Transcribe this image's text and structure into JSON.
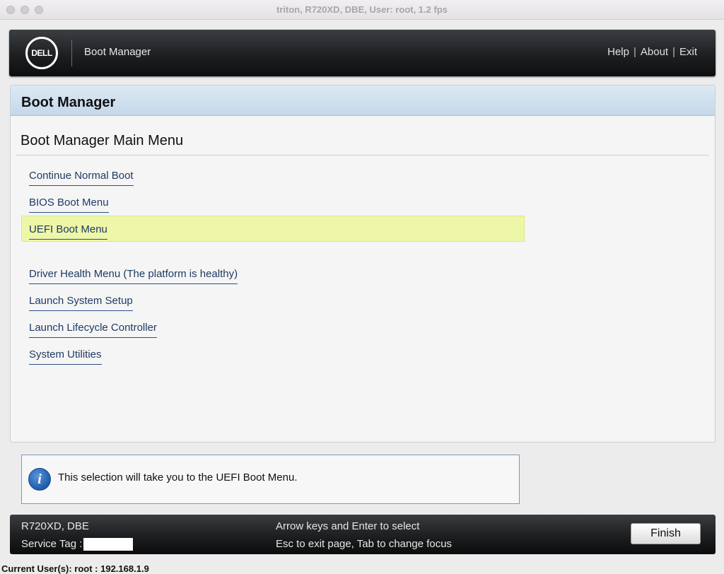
{
  "window": {
    "title": "triton, R720XD, DBE, User: root, 1.2 fps"
  },
  "header": {
    "logo_text": "DELL",
    "app_title": "Boot Manager",
    "links": {
      "help": "Help",
      "about": "About",
      "exit": "Exit",
      "separator": "|"
    }
  },
  "panel": {
    "title": "Boot Manager",
    "menu_title": "Boot Manager Main Menu",
    "items": [
      {
        "label": "Continue Normal Boot"
      },
      {
        "label": "BIOS Boot Menu"
      },
      {
        "label": "UEFI Boot Menu",
        "selected": true
      },
      {
        "label": "Driver Health Menu (The platform is healthy)"
      },
      {
        "label": "Launch System Setup"
      },
      {
        "label": "Launch Lifecycle Controller"
      },
      {
        "label": "System Utilities"
      }
    ]
  },
  "info": {
    "icon": "info-icon",
    "text": "This selection will take you to the UEFI Boot Menu."
  },
  "footer": {
    "model": "R720XD, DBE",
    "service_tag_label": "Service Tag :",
    "help_line1": "Arrow keys and Enter to select",
    "help_line2": "Esc to exit page, Tab to change focus",
    "finish_label": "Finish"
  },
  "status": {
    "text": "Current User(s): root : 192.168.1.9"
  },
  "colors": {
    "highlight": "#eef6a8",
    "link": "#1e3a64",
    "panel_header": "#c4d8ea"
  }
}
